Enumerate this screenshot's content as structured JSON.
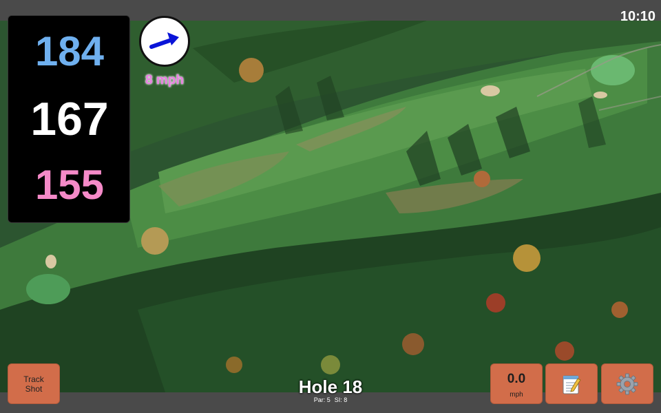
{
  "clock": "10:10",
  "distances": {
    "back": "184",
    "center": "167",
    "front": "155"
  },
  "wind": {
    "speed": "8 mph",
    "icon": "wind-direction-arrow-icon"
  },
  "buttons": {
    "track_shot": "Track Shot",
    "speed_value": "0.0",
    "speed_unit": "mph",
    "notes_icon": "notepad-icon",
    "settings_icon": "gear-icon"
  },
  "hole": {
    "title": "Hole 18",
    "par": "Par: 5",
    "si": "SI: 8"
  },
  "colors": {
    "back": "#6fb0ef",
    "center": "#ffffff",
    "front": "#f58ac8",
    "button": "#d26d4a",
    "wind_text": "#e87de0"
  }
}
